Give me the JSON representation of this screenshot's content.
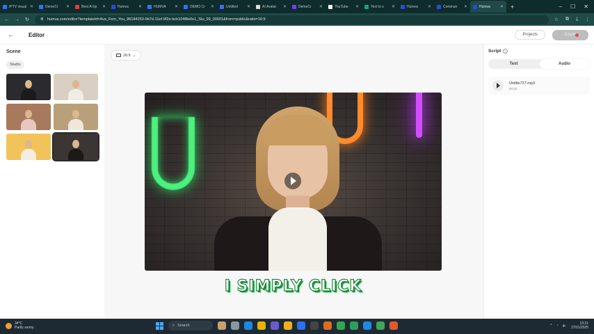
{
  "browser": {
    "tabs": [
      {
        "label": "IPTV visual",
        "color": "#3b6ef5"
      },
      {
        "label": "DemoCr",
        "color": "#3b6ef5"
      },
      {
        "label": "Best AI lip",
        "color": "#e33b3b"
      },
      {
        "label": "Humva",
        "color": "#2b4bd8"
      },
      {
        "label": "HUMVA",
        "color": "#3b6ef5"
      },
      {
        "label": "DEMO Cr",
        "color": "#3b6ef5"
      },
      {
        "label": "Untitled",
        "color": "#3b6ef5"
      },
      {
        "label": "AI Avatar",
        "color": "#dddddd"
      },
      {
        "label": "DemoCr",
        "color": "#7a3bf5"
      },
      {
        "label": "YouTube",
        "color": "#ffffff"
      },
      {
        "label": "Text to s",
        "color": "#11a37f"
      },
      {
        "label": "Humva",
        "color": "#2b4bd8"
      },
      {
        "label": "Commun",
        "color": "#2b4bd8"
      },
      {
        "label": "Humva",
        "color": "#2b4bd8"
      }
    ],
    "active_tab_index": 13,
    "url": "humva.com/editor?templateId=Ava_Fem_You_86184253-9b7d-11ef-9f2e-bcb104f8e0e1_Stu_99_00001&from=public&ratio=16:9"
  },
  "header": {
    "title": "Editor",
    "projects_label": "Projects",
    "export_label": "Export"
  },
  "scene": {
    "heading": "Scene",
    "filter_chip": "Studio",
    "thumbnails": [
      {
        "bg": "#2a2a2f",
        "body": "#1b1b1b"
      },
      {
        "bg": "#d9cfc2",
        "body": "#f2ece6"
      },
      {
        "bg": "#a87a5d",
        "body": "#e6c8c0"
      },
      {
        "bg": "#b8a17a",
        "body": "#efe7dc"
      },
      {
        "bg": "#f2c35a",
        "body": "#f5ece2"
      },
      {
        "bg": "#3b3533",
        "body": "#1e1818"
      }
    ],
    "selected_index": 5
  },
  "canvas": {
    "ratio_label": "16:9",
    "caption": "I SIMPLY CLICK"
  },
  "script": {
    "heading": "Script",
    "tabs": [
      "Text",
      "Audio"
    ],
    "active_tab": "Audio",
    "audio_file": {
      "name": "Untitle727.mp3",
      "duration": "00:02"
    }
  },
  "taskbar": {
    "weather_temp": "34°C",
    "weather_desc": "Partly sunny",
    "search_placeholder": "Search",
    "time": "13:21",
    "date": "27/01/2025",
    "app_colors": [
      "#c9a06a",
      "#8a97a3",
      "#1e88e5",
      "#e8b300",
      "#6a5acd",
      "#f2b01e",
      "#2f6fed",
      "#444444",
      "#e06b1d",
      "#2fa84f",
      "#2e9e5b",
      "#1e88e5",
      "#3fa75a",
      "#e3572b"
    ]
  }
}
